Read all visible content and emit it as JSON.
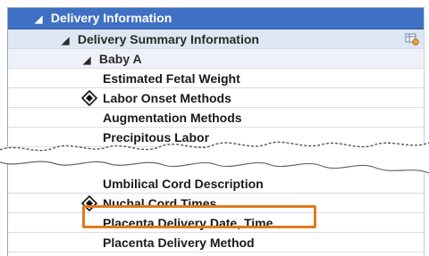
{
  "tree": {
    "section": {
      "label": "Delivery Information"
    },
    "subsection": {
      "label": "Delivery Summary Information"
    },
    "group": {
      "label": "Baby A"
    },
    "items": [
      {
        "label": "Estimated Fetal Weight"
      },
      {
        "label": "Labor Onset Methods",
        "icon": "required-diamond-icon"
      },
      {
        "label": "Augmentation Methods"
      },
      {
        "label": "Precipitous Labor"
      },
      {
        "label": "Umbilical Cord Description"
      },
      {
        "label": "Nuchal Cord Times",
        "icon": "required-diamond-icon"
      },
      {
        "label": "Placenta Delivery Date, Time",
        "highlighted": true
      },
      {
        "label": "Placenta Delivery Method"
      }
    ]
  },
  "colors": {
    "header": "#3f70c4",
    "highlight": "#e07a1f"
  }
}
